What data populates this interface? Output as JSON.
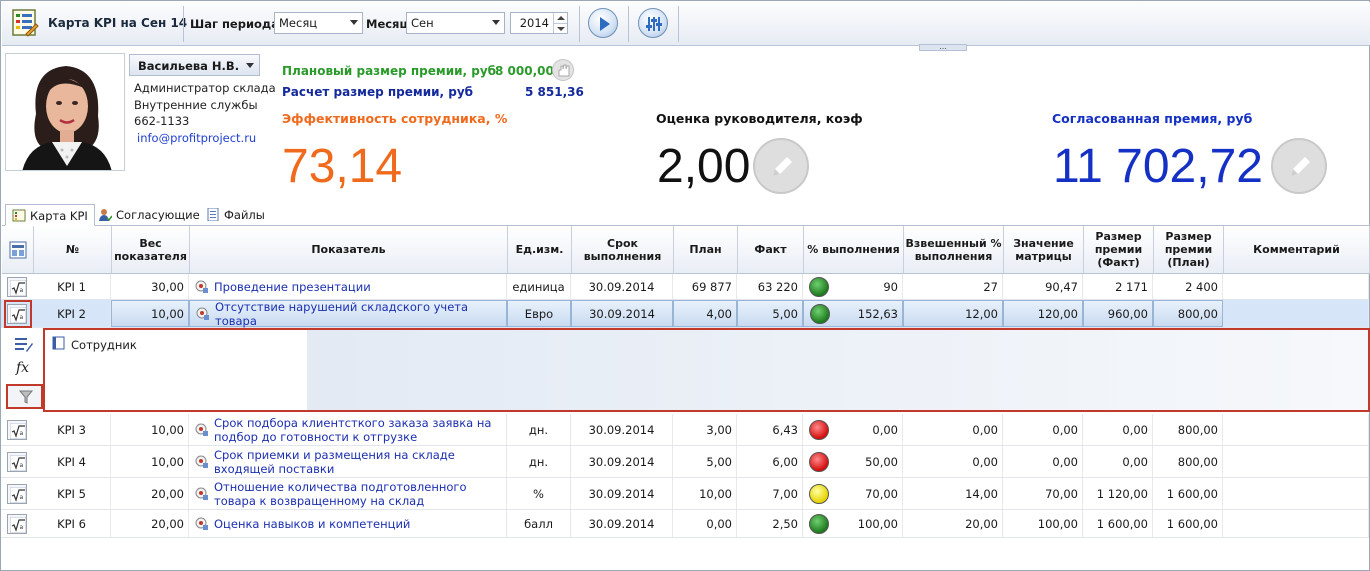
{
  "toolbar": {
    "title": "Карта KPI на Сен 14",
    "step_label": "Шаг периода:",
    "step_value": "Месяц",
    "month_label": "Месяц",
    "month_value": "Сен",
    "year_value": "2014",
    "grip": "..."
  },
  "employee": {
    "name": "Васильева Н.В.",
    "position": "Администратор склада",
    "department": "Внутренние службы",
    "phone": "662-1133",
    "email": "info@profitproject.ru"
  },
  "bonus": {
    "planned_label": "Плановый размер премии, руб",
    "planned_value": "8 000,00",
    "calc_label": "Расчет размер премии, руб",
    "calc_value": "5 851,36"
  },
  "metrics": {
    "efficiency_label": "Эффективность сотрудника, %",
    "efficiency_value": "73,14",
    "manager_label": "Оценка руководителя, коэф",
    "manager_value": "2,00",
    "agreed_label": "Согласованная премия, руб",
    "agreed_value": "11 702,72"
  },
  "tabs": [
    {
      "label": "Карта KPI"
    },
    {
      "label": "Согласующие"
    },
    {
      "label": "Файлы"
    }
  ],
  "columns": {
    "num": "№",
    "weight": "Вес показателя",
    "indicator": "Показатель",
    "unit": "Ед.изм.",
    "deadline": "Срок выполнения",
    "plan": "План",
    "fact": "Факт",
    "pct": "% выполнения",
    "weighted": "Взвешенный % выполнения",
    "matrix": "Значение матрицы",
    "bonus_fact": "Размер премии (Факт)",
    "bonus_plan": "Размер премии (План)",
    "comment": "Комментарий"
  },
  "rows": [
    {
      "num": "KPI 1",
      "weight": "30,00",
      "name": "Проведение презентации",
      "unit": "единица",
      "deadline": "30.09.2014",
      "plan": "69 877",
      "fact": "63 220",
      "lamp": "green",
      "pct": "90",
      "weighted": "27",
      "matrix": "90,47",
      "bonus_fact": "2 171",
      "bonus_plan": "2 400"
    },
    {
      "num": "KPI 2",
      "weight": "10,00",
      "name": "Отсутствие нарушений складского учета товара",
      "unit": "Евро",
      "deadline": "30.09.2014",
      "plan": "4,00",
      "fact": "5,00",
      "lamp": "green",
      "pct": "152,63",
      "weighted": "12,00",
      "matrix": "120,00",
      "bonus_fact": "960,00",
      "bonus_plan": "800,00"
    },
    {
      "num": "KPI 3",
      "weight": "10,00",
      "name": "Срок подбора клиентсткого заказа заявка на подбор до готовности к отгрузке",
      "unit": "дн.",
      "deadline": "30.09.2014",
      "plan": "3,00",
      "fact": "6,43",
      "lamp": "red",
      "pct": "0,00",
      "weighted": "0,00",
      "matrix": "0,00",
      "bonus_fact": "0,00",
      "bonus_plan": "800,00"
    },
    {
      "num": "KPI 4",
      "weight": "10,00",
      "name": "Срок приемки и размещения на складе входящей поставки",
      "unit": "дн.",
      "deadline": "30.09.2014",
      "plan": "5,00",
      "fact": "6,00",
      "lamp": "red",
      "pct": "50,00",
      "weighted": "0,00",
      "matrix": "0,00",
      "bonus_fact": "0,00",
      "bonus_plan": "800,00"
    },
    {
      "num": "KPI 5",
      "weight": "20,00",
      "name": "Отношение количества подготовленного товара к возвращенному на склад",
      "unit": "%",
      "deadline": "30.09.2014",
      "plan": "10,00",
      "fact": "7,00",
      "lamp": "yellow",
      "pct": "70,00",
      "weighted": "14,00",
      "matrix": "70,00",
      "bonus_fact": "1 120,00",
      "bonus_plan": "1 600,00"
    },
    {
      "num": "KPI 6",
      "weight": "20,00",
      "name": "Оценка навыков и компетенций",
      "unit": "балл",
      "deadline": "30.09.2014",
      "plan": "0,00",
      "fact": "2,50",
      "lamp": "green",
      "pct": "100,00",
      "weighted": "20,00",
      "matrix": "100,00",
      "bonus_fact": "1 600,00",
      "bonus_plan": "1 600,00"
    }
  ],
  "detail": {
    "title": "Сотрудник"
  },
  "colors": {
    "accent_orange": "#f06a1e",
    "accent_blue": "#1530c4",
    "accent_green": "#2a9a2a",
    "highlight_red": "#c0392b",
    "selection": "#d6e5f7"
  }
}
